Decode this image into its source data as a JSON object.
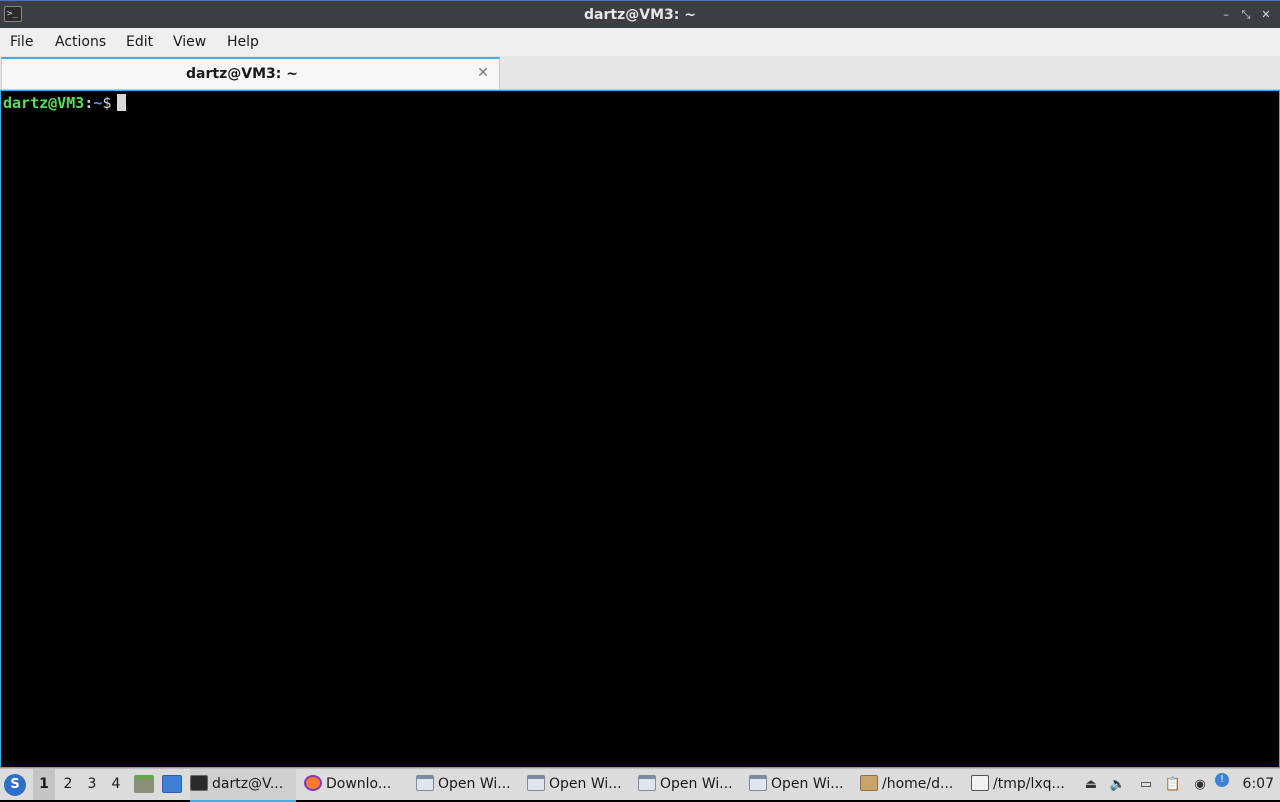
{
  "window": {
    "title": "dartz@VM3: ~",
    "app_icon": "terminal-icon",
    "controls": {
      "minimize": "–",
      "maximize": "⤡",
      "close": "✕"
    }
  },
  "menubar": {
    "items": [
      "File",
      "Actions",
      "Edit",
      "View",
      "Help"
    ]
  },
  "tabs": [
    {
      "label": "dartz@VM3: ~",
      "close": "✕"
    }
  ],
  "terminal": {
    "user_host": "dartz@VM3",
    "separator": ":",
    "path": "~",
    "dollar": "$",
    "colors": {
      "background": "#000000",
      "user": "#55e055",
      "path": "#6a8eff"
    }
  },
  "taskbar": {
    "start_icon": "start-menu-icon",
    "desktops": [
      "1",
      "2",
      "3",
      "4"
    ],
    "active_desktop": "1",
    "launchers": [
      "file-manager-icon",
      "show-desktop-icon"
    ],
    "tasks": [
      {
        "label": "dartz@V...",
        "icon": "terminal-icon",
        "active": true
      },
      {
        "label": "Downlo...",
        "icon": "firefox-icon",
        "active": false
      },
      {
        "label": "Open Wi...",
        "icon": "window-icon",
        "active": false
      },
      {
        "label": "Open Wi...",
        "icon": "window-icon",
        "active": false
      },
      {
        "label": "Open Wi...",
        "icon": "window-icon",
        "active": false
      },
      {
        "label": "Open Wi...",
        "icon": "window-icon",
        "active": false
      },
      {
        "label": "/home/d...",
        "icon": "folder-icon",
        "active": false
      },
      {
        "label": "/tmp/lxq...",
        "icon": "text-editor-icon",
        "active": false
      }
    ],
    "tray": [
      "eject-icon",
      "volume-icon",
      "network-icon",
      "clipboard-icon",
      "update-icon",
      "notification-icon"
    ],
    "clock": "6:07"
  }
}
